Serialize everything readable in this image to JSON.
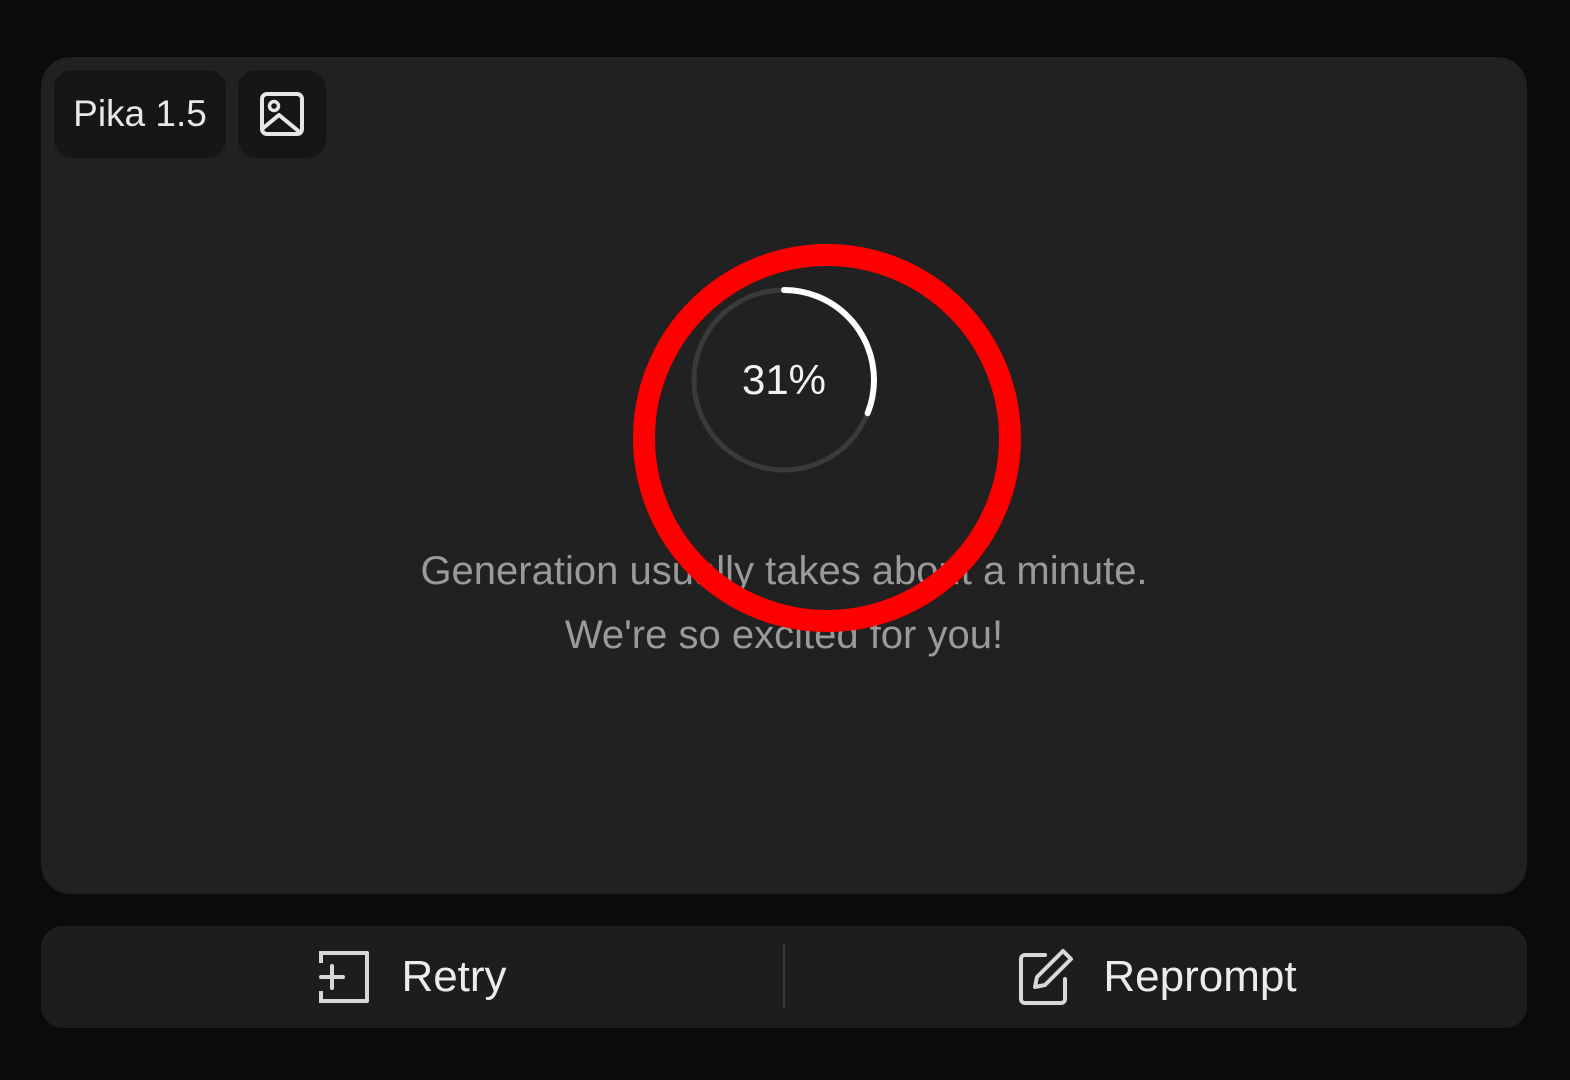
{
  "card": {
    "model_label": "Pika 1.5",
    "image_icon": "image-icon",
    "progress": {
      "percent": 31,
      "label": "31%",
      "track_color": "#3a3a3a",
      "fill_color": "#ffffff"
    },
    "message": "Generation usually takes about a minute. We're so excited for you!",
    "annotation_color": "#ff0000"
  },
  "actions": {
    "retry": {
      "label": "Retry",
      "icon": "retry-icon"
    },
    "reprompt": {
      "label": "Reprompt",
      "icon": "edit-icon"
    }
  }
}
